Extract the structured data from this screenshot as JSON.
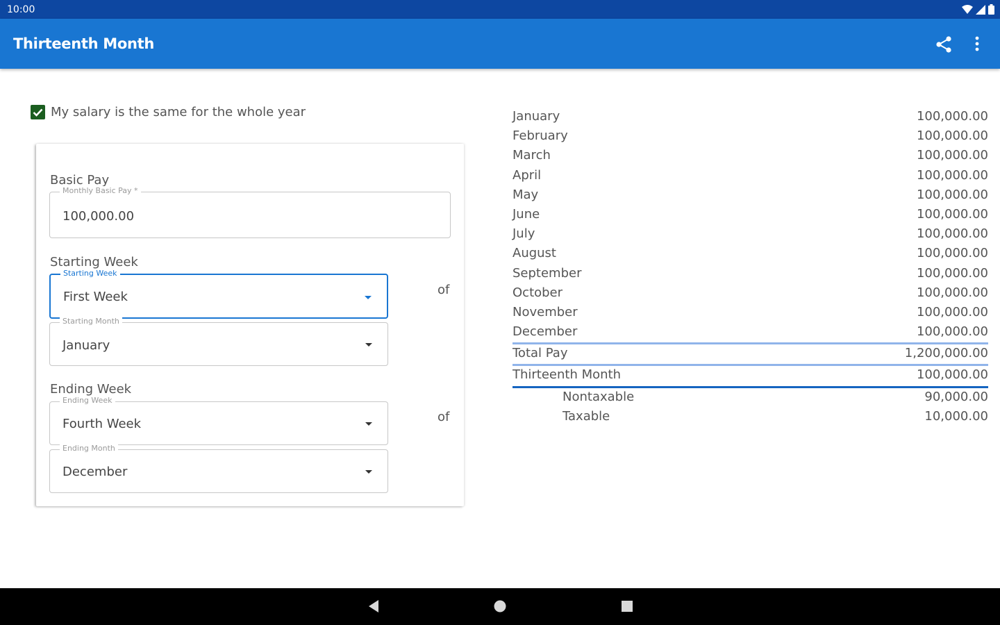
{
  "status": {
    "time": "10:00"
  },
  "appbar": {
    "title": "Thirteenth Month"
  },
  "form": {
    "same_salary_label": "My salary is the same for the whole year",
    "same_salary_checked": true,
    "basic_pay": {
      "title": "Basic Pay",
      "legend": "Monthly Basic Pay *",
      "value": "100,000.00"
    },
    "starting": {
      "title": "Starting Week",
      "week_legend": "Starting Week",
      "week_value": "First Week",
      "of_label": "of",
      "month_legend": "Starting Month",
      "month_value": "January"
    },
    "ending": {
      "title": "Ending Week",
      "week_legend": "Ending Week",
      "week_value": "Fourth Week",
      "of_label": "of",
      "month_legend": "Ending Month",
      "month_value": "December"
    }
  },
  "summary": {
    "months": [
      {
        "name": "January",
        "amount": "100,000.00"
      },
      {
        "name": "February",
        "amount": "100,000.00"
      },
      {
        "name": "March",
        "amount": "100,000.00"
      },
      {
        "name": "April",
        "amount": "100,000.00"
      },
      {
        "name": "May",
        "amount": "100,000.00"
      },
      {
        "name": "June",
        "amount": "100,000.00"
      },
      {
        "name": "July",
        "amount": "100,000.00"
      },
      {
        "name": "August",
        "amount": "100,000.00"
      },
      {
        "name": "September",
        "amount": "100,000.00"
      },
      {
        "name": "October",
        "amount": "100,000.00"
      },
      {
        "name": "November",
        "amount": "100,000.00"
      },
      {
        "name": "December",
        "amount": "100,000.00"
      }
    ],
    "total_pay": {
      "label": "Total Pay",
      "amount": "1,200,000.00"
    },
    "thirteenth_month": {
      "label": "Thirteenth Month",
      "amount": "100,000.00"
    },
    "nontaxable": {
      "label": "Nontaxable",
      "amount": "90,000.00"
    },
    "taxable": {
      "label": "Taxable",
      "amount": "10,000.00"
    }
  },
  "colors": {
    "status_bar": "#0d47a1",
    "app_bar": "#1976d2",
    "checkbox": "#1b5e20",
    "rule_light": "#90b4ea",
    "rule_dark": "#1565c0"
  },
  "icons": {
    "share": "share-icon",
    "more": "more-vert-icon",
    "back": "back-icon",
    "home": "home-icon",
    "recents": "recents-icon"
  }
}
